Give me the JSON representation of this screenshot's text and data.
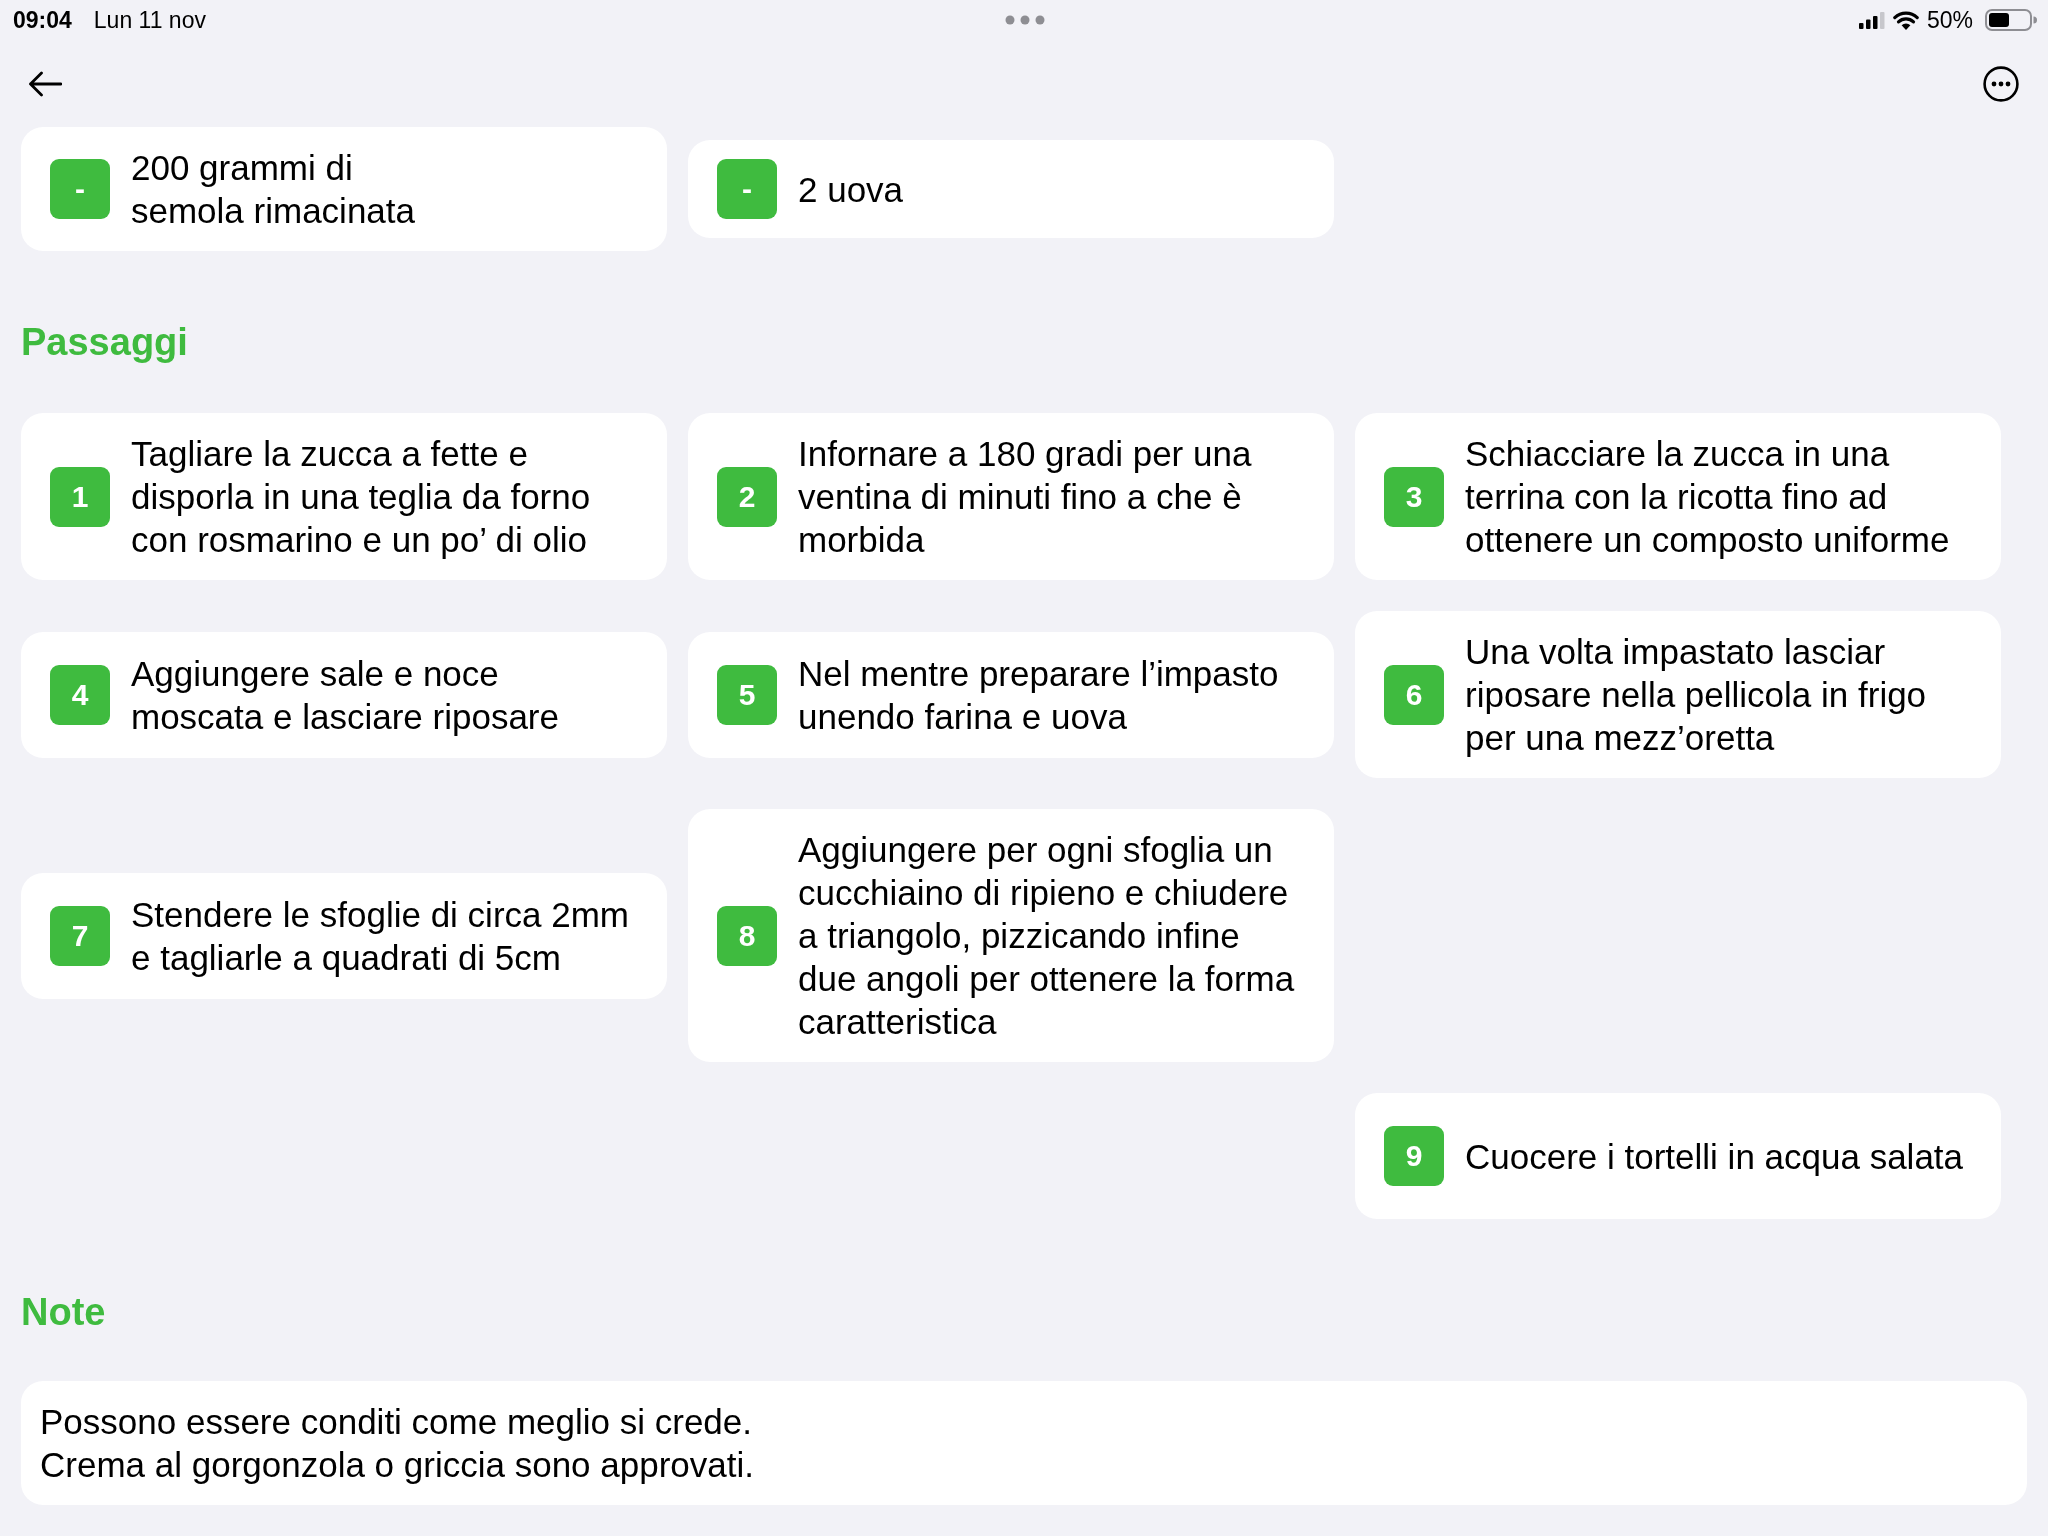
{
  "status_bar": {
    "time": "09:04",
    "date": "Lun 11 nov",
    "battery_percent": "50%"
  },
  "ingredients": [
    {
      "marker": "-",
      "text": "200 grammi di semola rimacinata"
    },
    {
      "marker": "-",
      "text": "2 uova"
    }
  ],
  "steps_section": {
    "heading": "Passaggi",
    "steps": [
      {
        "number": "1",
        "text": "Tagliare la zucca a fette e disporla in una teglia da forno con rosmarino e un po’ di olio"
      },
      {
        "number": "2",
        "text": "Infornare a 180 gradi per una ventina di minuti fino a che è morbida"
      },
      {
        "number": "3",
        "text": "Schiacciare la zucca in una terrina con la ricotta fino ad ottenere un composto uniforme"
      },
      {
        "number": "4",
        "text": "Aggiungere sale e noce moscata e lasciare riposare"
      },
      {
        "number": "5",
        "text": "Nel mentre preparare l’impasto unendo farina e uova"
      },
      {
        "number": "6",
        "text": "Una volta impastato lasciar riposare nella pellicola in frigo per una mezz’oretta"
      },
      {
        "number": "7",
        "text": "Stendere le sfoglie di circa 2mm e tagliarle a quadrati di 5cm"
      },
      {
        "number": "8",
        "text": "Aggiungere per ogni sfoglia un cucchiaino di ripieno e chiudere a triangolo, pizzicando infine due angoli per ottenere la forma caratteristica"
      },
      {
        "number": "9",
        "text": "Cuocere i tortelli in acqua salata"
      }
    ]
  },
  "notes_section": {
    "heading": "Note",
    "text": "Possono essere conditi come meglio si crede.\nCrema al gorgonzola o griccia sono approvati."
  }
}
